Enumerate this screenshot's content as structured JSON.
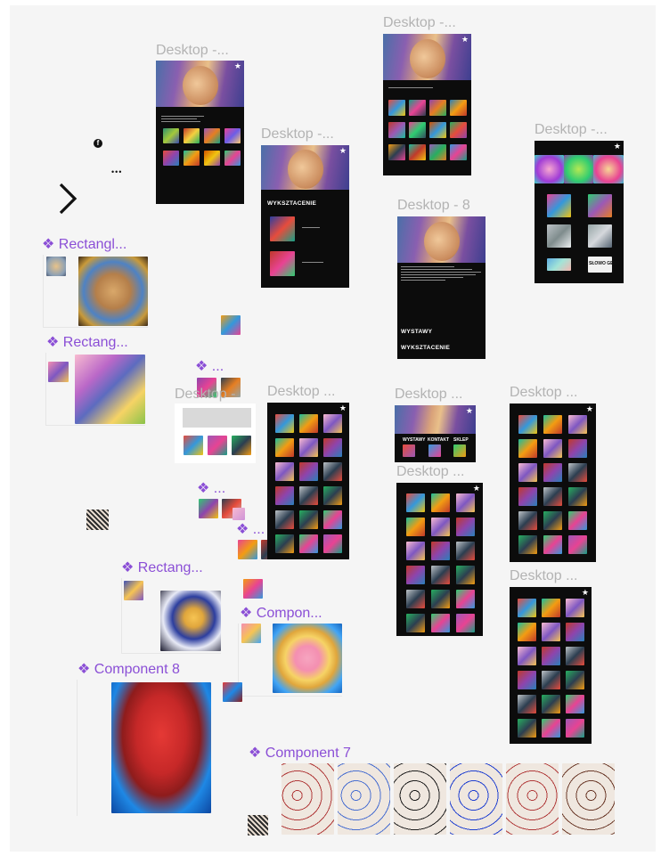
{
  "canvas": {
    "background": "#f5f5f5",
    "label_color": "#b3b3b3",
    "component_color": "#8b4fd6"
  },
  "icons": [
    "facebook-icon",
    "more-dots-icon",
    "chevron-right-icon",
    "component-diamond-icon",
    "star-icon"
  ],
  "frames": {
    "desktop_a": "Desktop -...",
    "desktop_b": "Desktop -...",
    "desktop_c": "Desktop -...",
    "desktop_d": "Desktop -...",
    "desktop_8": "Desktop - 8",
    "desktop_grid_left": "Desktop ...",
    "desktop_grid_mid_top": "Desktop ...",
    "desktop_grid_mid": "Desktop ...",
    "desktop_grid_right_top": "Desktop ...",
    "desktop_grid_right_bottom": "Desktop ...",
    "desktop_small": "Desktop -"
  },
  "frame_text": {
    "wyksztacenie": "WYKSZTACENIE",
    "wystawy": "WYSTAWY",
    "wyksztacenie_2": "WYKSZTACENIE",
    "nav_1": "WYSTAWY",
    "nav_2": "KONTAKT",
    "nav_3": "SKLEP",
    "poster_text": "SŁOWO GENY"
  },
  "components": {
    "rect_1": "Rectangl...",
    "rect_2": "Rectang...",
    "group_1": "...",
    "group_2": "...",
    "group_3": "...",
    "rect_3": "Rectang...",
    "compon": "Compon...",
    "component_8": "Component 8",
    "component_7": "Component 7"
  },
  "diamond": "❖",
  "facebook": "f",
  "dots": "•••",
  "star": "★"
}
